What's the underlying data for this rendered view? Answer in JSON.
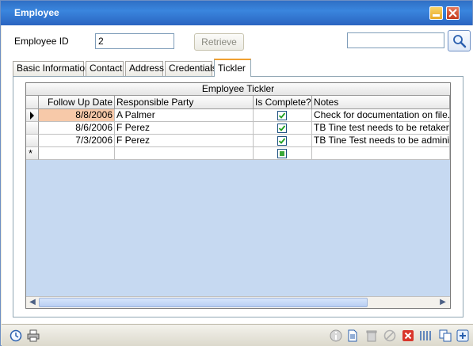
{
  "window": {
    "title": "Employee"
  },
  "form": {
    "employee_id_label": "Employee ID",
    "employee_id_value": "2",
    "retrieve_label": "Retrieve",
    "search_value": ""
  },
  "tabs": [
    {
      "label": "Basic Information"
    },
    {
      "label": "Contact"
    },
    {
      "label": "Address"
    },
    {
      "label": "Credentials"
    },
    {
      "label": "Tickler",
      "active": true
    }
  ],
  "grid": {
    "caption": "Employee Tickler",
    "columns": [
      "Follow Up Date",
      "Responsible Party",
      "Is Complete?",
      "Notes"
    ],
    "rows": [
      {
        "date": "8/8/2006",
        "party": "A Palmer",
        "complete": true,
        "notes": "Check for documentation on file.",
        "current": true
      },
      {
        "date": "8/6/2006",
        "party": "F Perez",
        "complete": true,
        "notes": "TB Tine test needs to be retaken"
      },
      {
        "date": "7/3/2006",
        "party": "F Perez",
        "complete": true,
        "notes": "TB Tine Test needs to be administered"
      }
    ],
    "new_row_marker": "*"
  },
  "colors": {
    "title_bar": "#2f6fc5",
    "grid_background": "#c6d9f1",
    "selected_cell": "#f7c9a9",
    "active_tab_accent": "#f0a030"
  },
  "statusbar_icons": [
    "history-icon",
    "print-icon",
    "info-icon",
    "document-icon",
    "trash-icon",
    "cancel-icon",
    "delete-icon",
    "separator-icon",
    "copy-icon",
    "add-icon"
  ]
}
